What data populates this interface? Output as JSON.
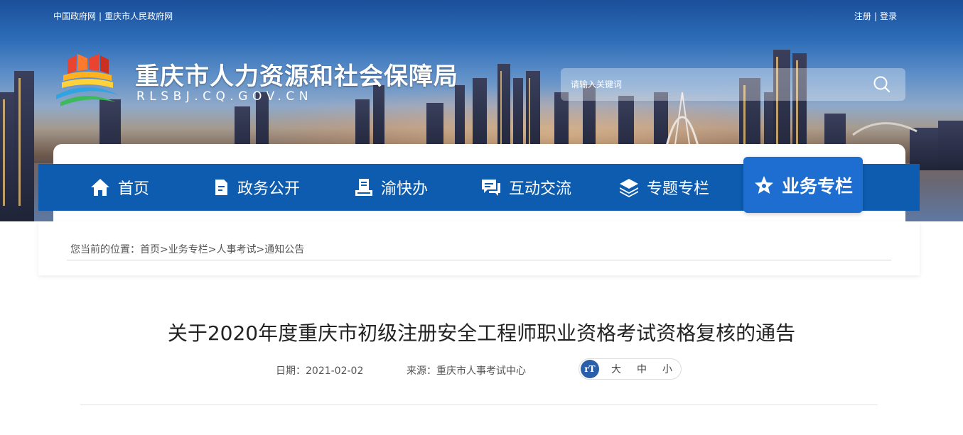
{
  "topbar": {
    "left_links": [
      "中国政府网",
      "重庆市人民政府网"
    ],
    "separator": "|",
    "right_links": [
      "注册",
      "登录"
    ]
  },
  "site": {
    "title": "重庆市人力资源和社会保障局",
    "subtitle": "RLSBJ.CQ.GOV.CN"
  },
  "search": {
    "placeholder": "请输入关键词",
    "icon": "search-icon"
  },
  "nav": {
    "items": [
      {
        "label": "首页",
        "icon": "home-icon"
      },
      {
        "label": "政务公开",
        "icon": "document-icon"
      },
      {
        "label": "渝快办",
        "icon": "service-icon"
      },
      {
        "label": "互动交流",
        "icon": "chat-icon"
      },
      {
        "label": "专题专栏",
        "icon": "layers-icon"
      },
      {
        "label": "业务专栏",
        "icon": "star-icon",
        "active": true
      }
    ],
    "bar_color": "#0d5cb0",
    "active_color": "#1d6ed0"
  },
  "breadcrumb": {
    "prefix": "您当前的位置：",
    "items": [
      "首页",
      "业务专栏",
      "人事考试",
      "通知公告"
    ],
    "separator": ">"
  },
  "article": {
    "title": "关于2020年度重庆市初级注册安全工程师职业资格考试资格复核的通告",
    "date_label": "日期：",
    "date": "2021-02-02",
    "source_label": "来源：",
    "source": "重庆市人事考试中心",
    "font_size_options": [
      "大",
      "中",
      "小"
    ],
    "font_icon_text": "rT"
  }
}
